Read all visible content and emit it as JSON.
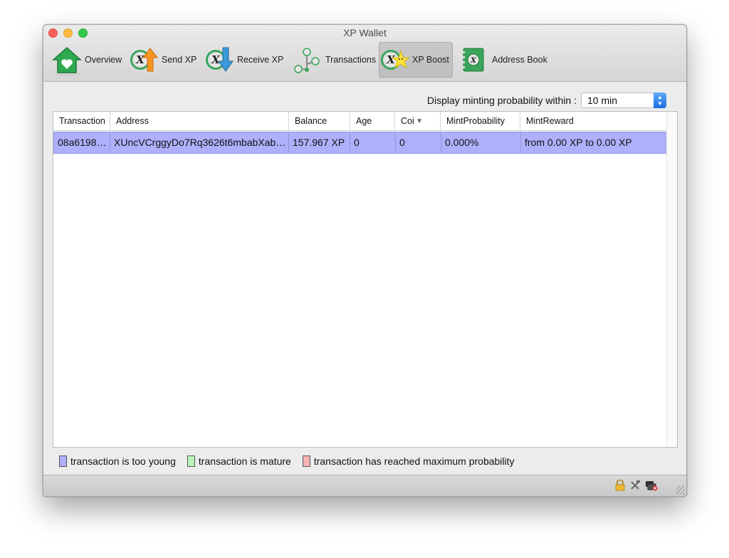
{
  "window": {
    "title": "XP Wallet"
  },
  "toolbar": {
    "items": [
      {
        "label": "Overview",
        "icon": "home-icon"
      },
      {
        "label": "Send XP",
        "icon": "send-icon"
      },
      {
        "label": "Receive XP",
        "icon": "receive-icon"
      },
      {
        "label": "Transactions",
        "icon": "transactions-icon"
      },
      {
        "label": "XP Boost",
        "icon": "boost-icon",
        "active": true
      },
      {
        "label": "Address Book",
        "icon": "address-book-icon"
      }
    ],
    "coin_letter": "X"
  },
  "minting": {
    "label": "Display minting probability within :",
    "selected": "10 min"
  },
  "table": {
    "columns": [
      "Transaction",
      "Address",
      "Balance",
      "Age",
      "CoinDay",
      "MintProbability",
      "MintReward"
    ],
    "column_labels": [
      "Transaction",
      "Address",
      "Balance",
      "Age",
      "Coi",
      "MintProbability",
      "MintReward"
    ],
    "rows": [
      {
        "transaction": "08a6198…",
        "address": "XUncVCrggyDo7Rq3626t6mbabXab…",
        "balance": "157.967 XP",
        "age": "0",
        "coinday": "0",
        "probability": "0.000%",
        "reward": "from  0.00 XP to 0.00 XP"
      }
    ]
  },
  "legend": {
    "young": {
      "label": "transaction is too young",
      "color": "#aeb0fb"
    },
    "mature": {
      "label": "transaction is mature",
      "color": "#b9f5b9"
    },
    "max": {
      "label": "transaction has reached maximum probability",
      "color": "#f7b3b3"
    }
  },
  "status": {
    "icons": [
      "lock-icon",
      "tools-icon",
      "network-icon"
    ]
  }
}
